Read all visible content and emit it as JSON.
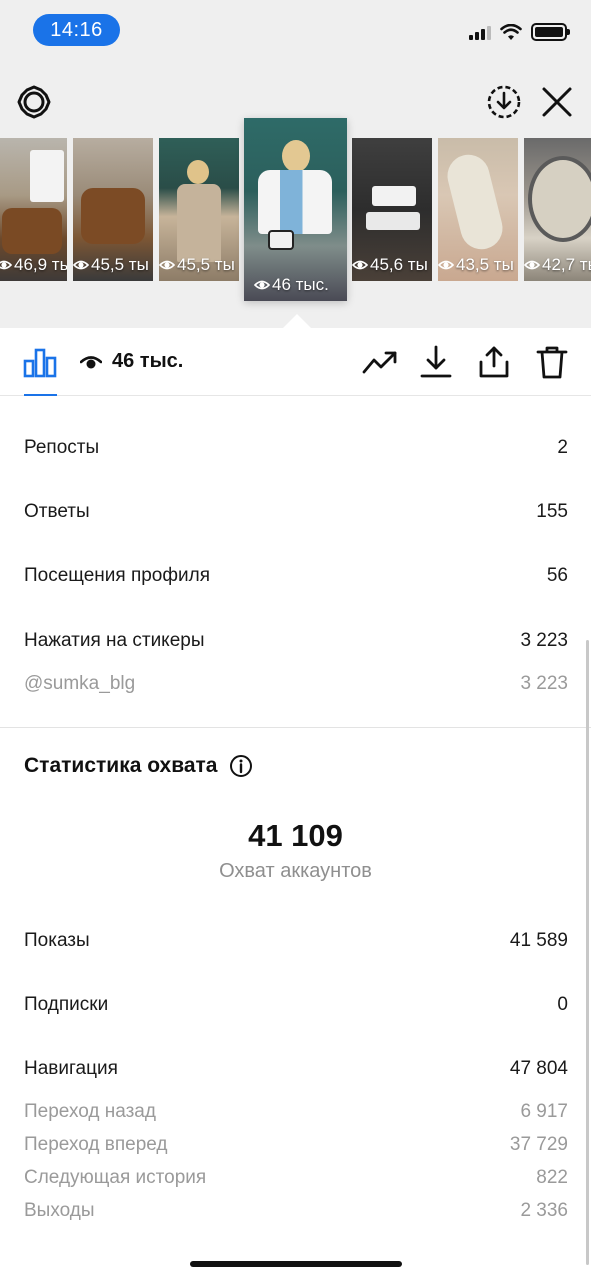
{
  "status_bar": {
    "time": "14:16"
  },
  "thumbnails": [
    {
      "views": "46,9 ты"
    },
    {
      "views": "45,5 ты"
    },
    {
      "views": "45,5 ты"
    },
    {
      "views": "46 тыс.",
      "selected": true
    },
    {
      "views": "45,6 ты"
    },
    {
      "views": "43,5 ты"
    },
    {
      "views": "42,7 ты"
    }
  ],
  "toolbar": {
    "views": "46 тыс."
  },
  "stats": [
    {
      "label": "Репосты",
      "value": "2"
    },
    {
      "label": "Ответы",
      "value": "155"
    },
    {
      "label": "Посещения профиля",
      "value": "56"
    },
    {
      "label": "Нажатия на стикеры",
      "value": "3 223"
    },
    {
      "label": "@sumka_blg",
      "value": "3 223"
    }
  ],
  "reach": {
    "title": "Статистика охвата",
    "number": "41 109",
    "number_label": "Охват аккаунтов",
    "rows": [
      {
        "label": "Показы",
        "value": "41 589"
      },
      {
        "label": "Подписки",
        "value": "0"
      },
      {
        "label": "Навигация",
        "value": "47 804"
      },
      {
        "label": "Переход назад",
        "value": "6 917"
      },
      {
        "label": "Переход вперед",
        "value": "37 729"
      },
      {
        "label": "Следующая история",
        "value": "822"
      },
      {
        "label": "Выходы",
        "value": "2 336"
      }
    ]
  },
  "colors": {
    "accent": "#1a73e8",
    "top_bg": "#efefef",
    "muted": "#9a9a9a"
  }
}
